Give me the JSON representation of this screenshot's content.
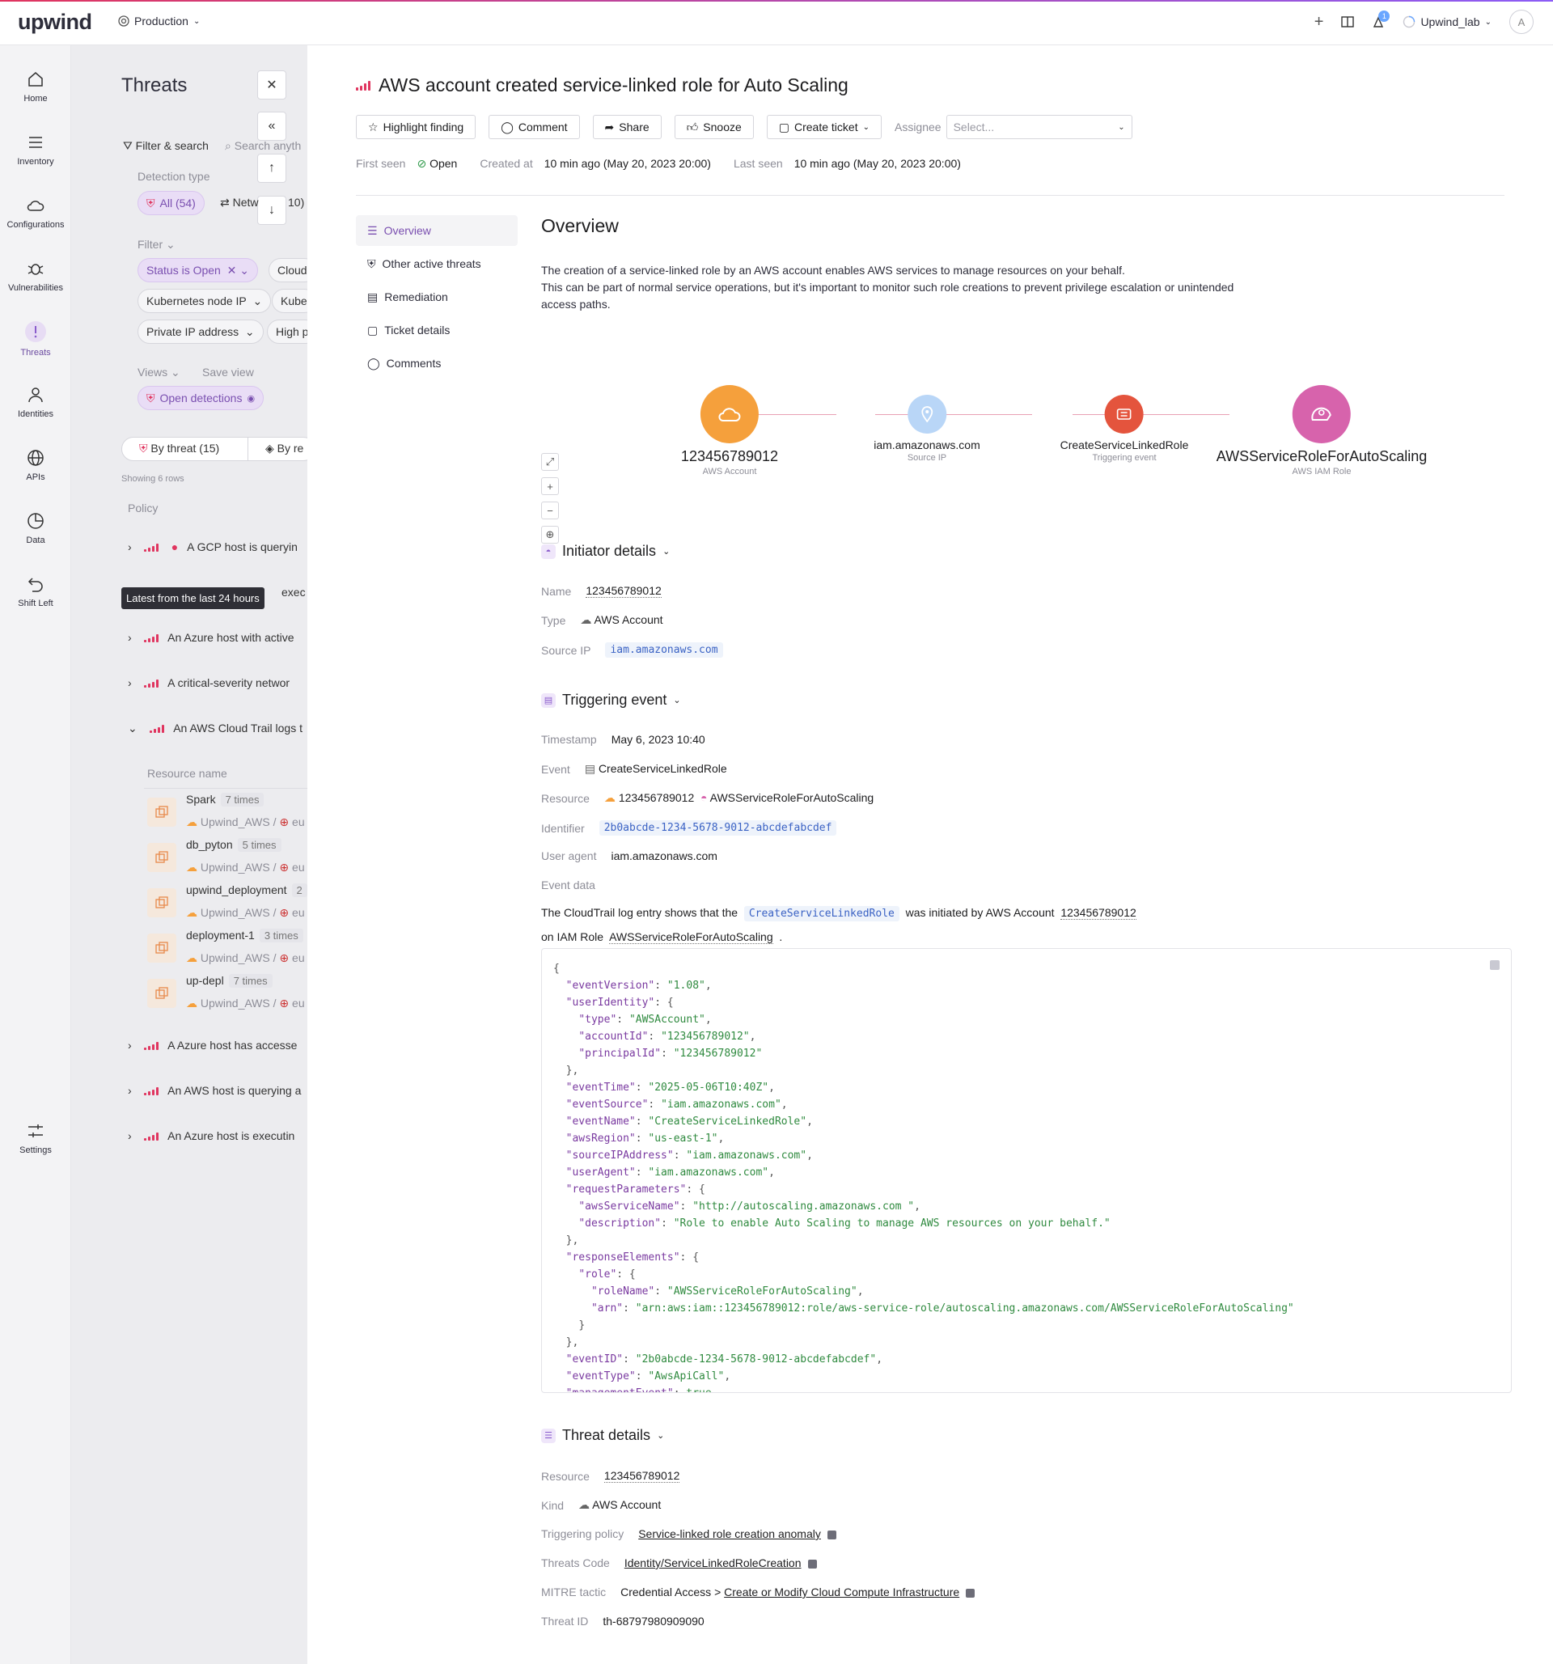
{
  "topbar": {
    "logo": "upwind",
    "environment": "Production",
    "notification_count": "1",
    "org": "Upwind_lab",
    "avatar": "A"
  },
  "nav": {
    "items": [
      {
        "label": "Home",
        "icon": "home-icon"
      },
      {
        "label": "Inventory",
        "icon": "inventory-icon"
      },
      {
        "label": "Configurations",
        "icon": "cloud-icon"
      },
      {
        "label": "Vulnerabilities",
        "icon": "bug-icon"
      },
      {
        "label": "Threats",
        "icon": "exclamation-icon"
      },
      {
        "label": "Identities",
        "icon": "person-icon"
      },
      {
        "label": "APIs",
        "icon": "globe-icon"
      },
      {
        "label": "Data",
        "icon": "pie-icon"
      },
      {
        "label": "Shift Left",
        "icon": "undo-icon"
      },
      {
        "label": "Settings",
        "icon": "sliders-icon"
      }
    ]
  },
  "threats_panel": {
    "title": "Threats",
    "filter_search": "Filter & search",
    "search_placeholder": "Search anyth",
    "detection_type": "Detection type",
    "all_chip": "All (54)",
    "network_chip": "Netw",
    "network_count": "10)",
    "filter_label": "Filter",
    "chips": [
      "Status is Open",
      "Cloud",
      "Kubernetes node IP",
      "Kube",
      "Private IP address",
      "High p"
    ],
    "views_label": "Views",
    "save_view": "Save view",
    "open_detections": "Open detections",
    "by_threat": "By threat (15)",
    "by_re": "By re",
    "showing": "Showing 6 rows",
    "policy_header": "Policy",
    "tooltip": "Latest from the last 24 hours",
    "rows": [
      "A GCP host is queryin",
      "exec",
      "An Azure host with active",
      "A critical-severity networ",
      "An AWS Cloud Trail logs t",
      "A Azure host has accesse",
      "An AWS host is querying a",
      "An Azure host is executin"
    ],
    "resource_header": "Resource name",
    "resources": [
      {
        "name": "Spark",
        "times": "7 times",
        "account": "Upwind_AWS",
        "region": "eu"
      },
      {
        "name": "db_pyton",
        "times": "5 times",
        "account": "Upwind_AWS",
        "region": "eu"
      },
      {
        "name": "upwind_deployment",
        "times": "2",
        "account": "Upwind_AWS",
        "region": "eu"
      },
      {
        "name": "deployment-1",
        "times": "3 times",
        "account": "Upwind_AWS",
        "region": "eu"
      },
      {
        "name": "up-depl",
        "times": "7 times",
        "account": "Upwind_AWS",
        "region": "eu"
      }
    ]
  },
  "detail": {
    "title": "AWS account created service-linked role for Auto Scaling",
    "buttons": {
      "highlight": "Highlight finding",
      "comment": "Comment",
      "share": "Share",
      "snooze": "Snooze",
      "create_ticket": "Create ticket",
      "assignee_label": "Assignee",
      "assignee_placeholder": "Select..."
    },
    "meta": {
      "first_seen_label": "First seen",
      "status": "Open",
      "created_label": "Created at",
      "created_value": "10 min ago (May 20, 2023 20:00)",
      "last_seen_label": "Last seen",
      "last_seen_value": "10 min ago (May 20, 2023 20:00)"
    },
    "subnav": [
      "Overview",
      "Other active threats",
      "Remediation",
      "Ticket details",
      "Comments"
    ],
    "overview": {
      "heading": "Overview",
      "line1": "The creation of a service-linked role by an AWS account enables AWS services to manage resources on your behalf.",
      "line2": "This can be part of normal service operations, but it's important to monitor such role creations to prevent privilege escalation or unintended",
      "line3": "access paths."
    },
    "graph": {
      "nodes": [
        {
          "name": "123456789012",
          "sub": "AWS Account",
          "color": "#f5a03c"
        },
        {
          "name": "iam.amazonaws.com",
          "sub": "Source IP",
          "color": "#b9d6f7"
        },
        {
          "name": "CreateServiceLinkedRole",
          "sub": "Triggering event",
          "color": "#e4543d"
        },
        {
          "name": "AWSServiceRoleForAutoScaling",
          "sub": "AWS IAM Role",
          "color": "#d763ac"
        }
      ]
    },
    "initiator": {
      "heading": "Initiator details",
      "name_label": "Name",
      "name": "123456789012",
      "type_label": "Type",
      "type": "AWS Account",
      "source_ip_label": "Source IP",
      "source_ip": "iam.amazonaws.com"
    },
    "triggering": {
      "heading": "Triggering event",
      "timestamp_label": "Timestamp",
      "timestamp": "May 6, 2023 10:40",
      "event_label": "Event",
      "event": "CreateServiceLinkedRole",
      "resource_label": "Resource",
      "resource_account": "123456789012",
      "resource_role": "AWSServiceRoleForAutoScaling",
      "identifier_label": "Identifier",
      "identifier": "2b0abcde-1234-5678-9012-abcdefabcdef",
      "user_agent_label": "User agent",
      "user_agent": "iam.amazonaws.com",
      "event_data_label": "Event data",
      "summary_pre": "The CloudTrail log entry shows that the",
      "summary_event": "CreateServiceLinkedRole",
      "summary_mid": "was initiated by AWS Account",
      "summary_account": "123456789012",
      "summary_role_pre": "on IAM Role",
      "summary_role": "AWSServiceRoleForAutoScaling",
      "summary_end": "."
    },
    "threat_details": {
      "heading": "Threat details",
      "resource_label": "Resource",
      "resource": "123456789012",
      "kind_label": "Kind",
      "kind": "AWS Account",
      "policy_label": "Triggering policy",
      "policy": "Service-linked role creation anomaly",
      "code_label": "Threats Code",
      "code": "Identity/ServiceLinkedRoleCreation",
      "mitre_label": "MITRE tactic",
      "mitre_tactic": "Credential Access >",
      "mitre_technique": "Create or Modify Cloud Compute Infrastructure",
      "id_label": "Threat ID",
      "id": "th-68797980909090"
    }
  }
}
